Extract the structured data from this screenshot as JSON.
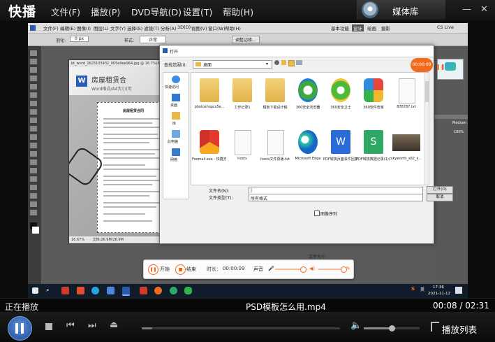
{
  "app": {
    "logo": "快播",
    "menu": [
      "文件(F)",
      "播放(P)",
      "DVD导航(D)",
      "设置(T)",
      "帮助(H)"
    ],
    "media_library": "媒体库"
  },
  "window_controls": {
    "minimize": "—",
    "close": "✕"
  },
  "photoshop": {
    "menu": [
      "文件(F)",
      "编辑(E)",
      "图像(I)",
      "图层(L)",
      "文字(Y)",
      "选择(S)",
      "滤镜(T)",
      "分析(A)",
      "3D(D)",
      "视图(V)",
      "窗口(W)",
      "帮助(H)"
    ],
    "workspace": [
      "基本功能",
      "设计",
      "绘画",
      "摄影"
    ],
    "options": {
      "feather_label": "羽化:",
      "feather_value": "0 px",
      "style_label": "样式:",
      "style_value": "正常",
      "refine_edge": "调整边缘..."
    },
    "cslive": "CS Live",
    "right_panel": {
      "blend": "Medium",
      "percent": "100%"
    },
    "doc_title": "bt_word_1625103432_005e9ee964.jpg @ 16.7%(RGB/8)",
    "doc_heading": "房屋租赁合",
    "doc_sub": "Word格式/A4大小(可",
    "doc_contract": "房屋租赁合同",
    "doc_zoom": "16.67%",
    "doc_size": "文档:26.9M/26.9M"
  },
  "open_dialog": {
    "title": "打开",
    "look_in_label": "查找范围(I):",
    "look_in_value": "桌面",
    "sidebar": [
      "快速访问",
      "桌面",
      "库",
      "此电脑",
      "网络"
    ],
    "files": [
      "photoshopcs5e...",
      "工作记录1",
      "模板下载设计稿",
      "360安全浏览器",
      "360安全卫士",
      "360软件管家",
      "878787.txt",
      "Foxmail.exe - 快捷方式",
      "hosts",
      "hosts文件原版.txt",
      "Microsoft Edge",
      "PDF转换页面事件回复术语 11.10...",
      "PDF转换数据记录(1)(1)(1).xlsx",
      "skyworth_s82_k..."
    ],
    "file_name_label": "文件名(N):",
    "file_name_value": "|",
    "file_type_label": "文件类型(T):",
    "file_type_value": "所有格式",
    "sequence_label": "图像序列",
    "file_size_label": "文件大小:",
    "open_button": "打开(O)",
    "cancel_button": "取消"
  },
  "recorder": {
    "start": "开始",
    "stop": "结束",
    "duration_label": "时长：",
    "duration": "00:00:09",
    "sound_label": "声音",
    "badge": "00:00:09"
  },
  "taskbar": {
    "time": "17:36",
    "date": "2021-11-12",
    "sogou": "S",
    "lang": "英"
  },
  "player": {
    "status": "正在播放",
    "file_name": "PSD模板怎么用.mp4",
    "time": "00:08 / 02:31",
    "progress": 0.053,
    "volume": 0.5,
    "playlist_label": "播放列表"
  }
}
